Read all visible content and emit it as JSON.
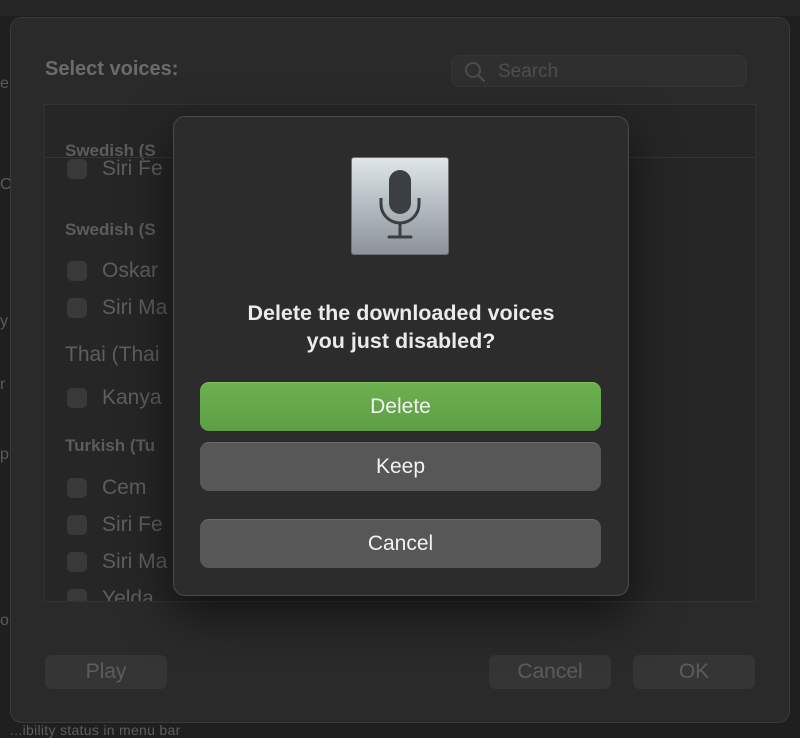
{
  "background": {
    "left_edge_glyphs": [
      "e",
      "O",
      "y",
      "r",
      "p",
      "o"
    ],
    "bottom_text": "...ibility status in menu bar"
  },
  "voices_sheet": {
    "title": "Select voices:",
    "search": {
      "placeholder": "Search"
    },
    "list": {
      "groups": [
        {
          "heading": "Swedish (S",
          "voices": [
            "Siri Fe"
          ]
        },
        {
          "heading": "Swedish (S",
          "voices": [
            "Oskar",
            "Siri Ma"
          ]
        },
        {
          "heading": "Thai (Thai",
          "voices": [
            "Kanya"
          ]
        },
        {
          "heading": "Turkish (Tu",
          "voices": [
            "Cem",
            "Siri Fe",
            "Siri Ma",
            "Yelda"
          ]
        }
      ]
    },
    "buttons": {
      "play": "Play",
      "cancel": "Cancel",
      "ok": "OK"
    }
  },
  "dialog": {
    "icon": "microphone-icon",
    "message_line1": "Delete the downloaded voices",
    "message_line2": "you just disabled?",
    "buttons": {
      "delete": "Delete",
      "keep": "Keep",
      "cancel": "Cancel"
    }
  },
  "colors": {
    "accent_green": "#62A648",
    "dialog_bg": "#2C2C2C",
    "button_gray": "#575757"
  }
}
